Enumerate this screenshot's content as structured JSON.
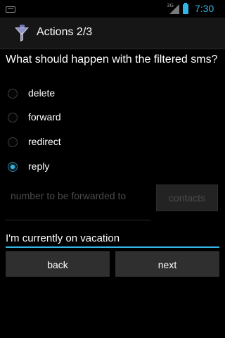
{
  "status_bar": {
    "network": "3G",
    "time": "7:30"
  },
  "action_bar": {
    "title": "Actions 2/3",
    "icon": "funnel-filter-icon"
  },
  "question": "What should happen with the filtered sms?",
  "options": [
    {
      "label": "delete",
      "checked": false
    },
    {
      "label": "forward",
      "checked": false
    },
    {
      "label": "redirect",
      "checked": false
    },
    {
      "label": "reply",
      "checked": true
    }
  ],
  "number_field": {
    "placeholder": "number to be forwarded to",
    "value": ""
  },
  "contacts_button": {
    "label": "contacts",
    "enabled": false
  },
  "message_field": {
    "value": "I'm currently on vacation"
  },
  "nav": {
    "back_label": "back",
    "next_label": "next"
  },
  "colors": {
    "accent": "#33b5e5",
    "background": "#000000",
    "button": "#2f2f2f",
    "disabled_text": "#4b4b4b"
  }
}
